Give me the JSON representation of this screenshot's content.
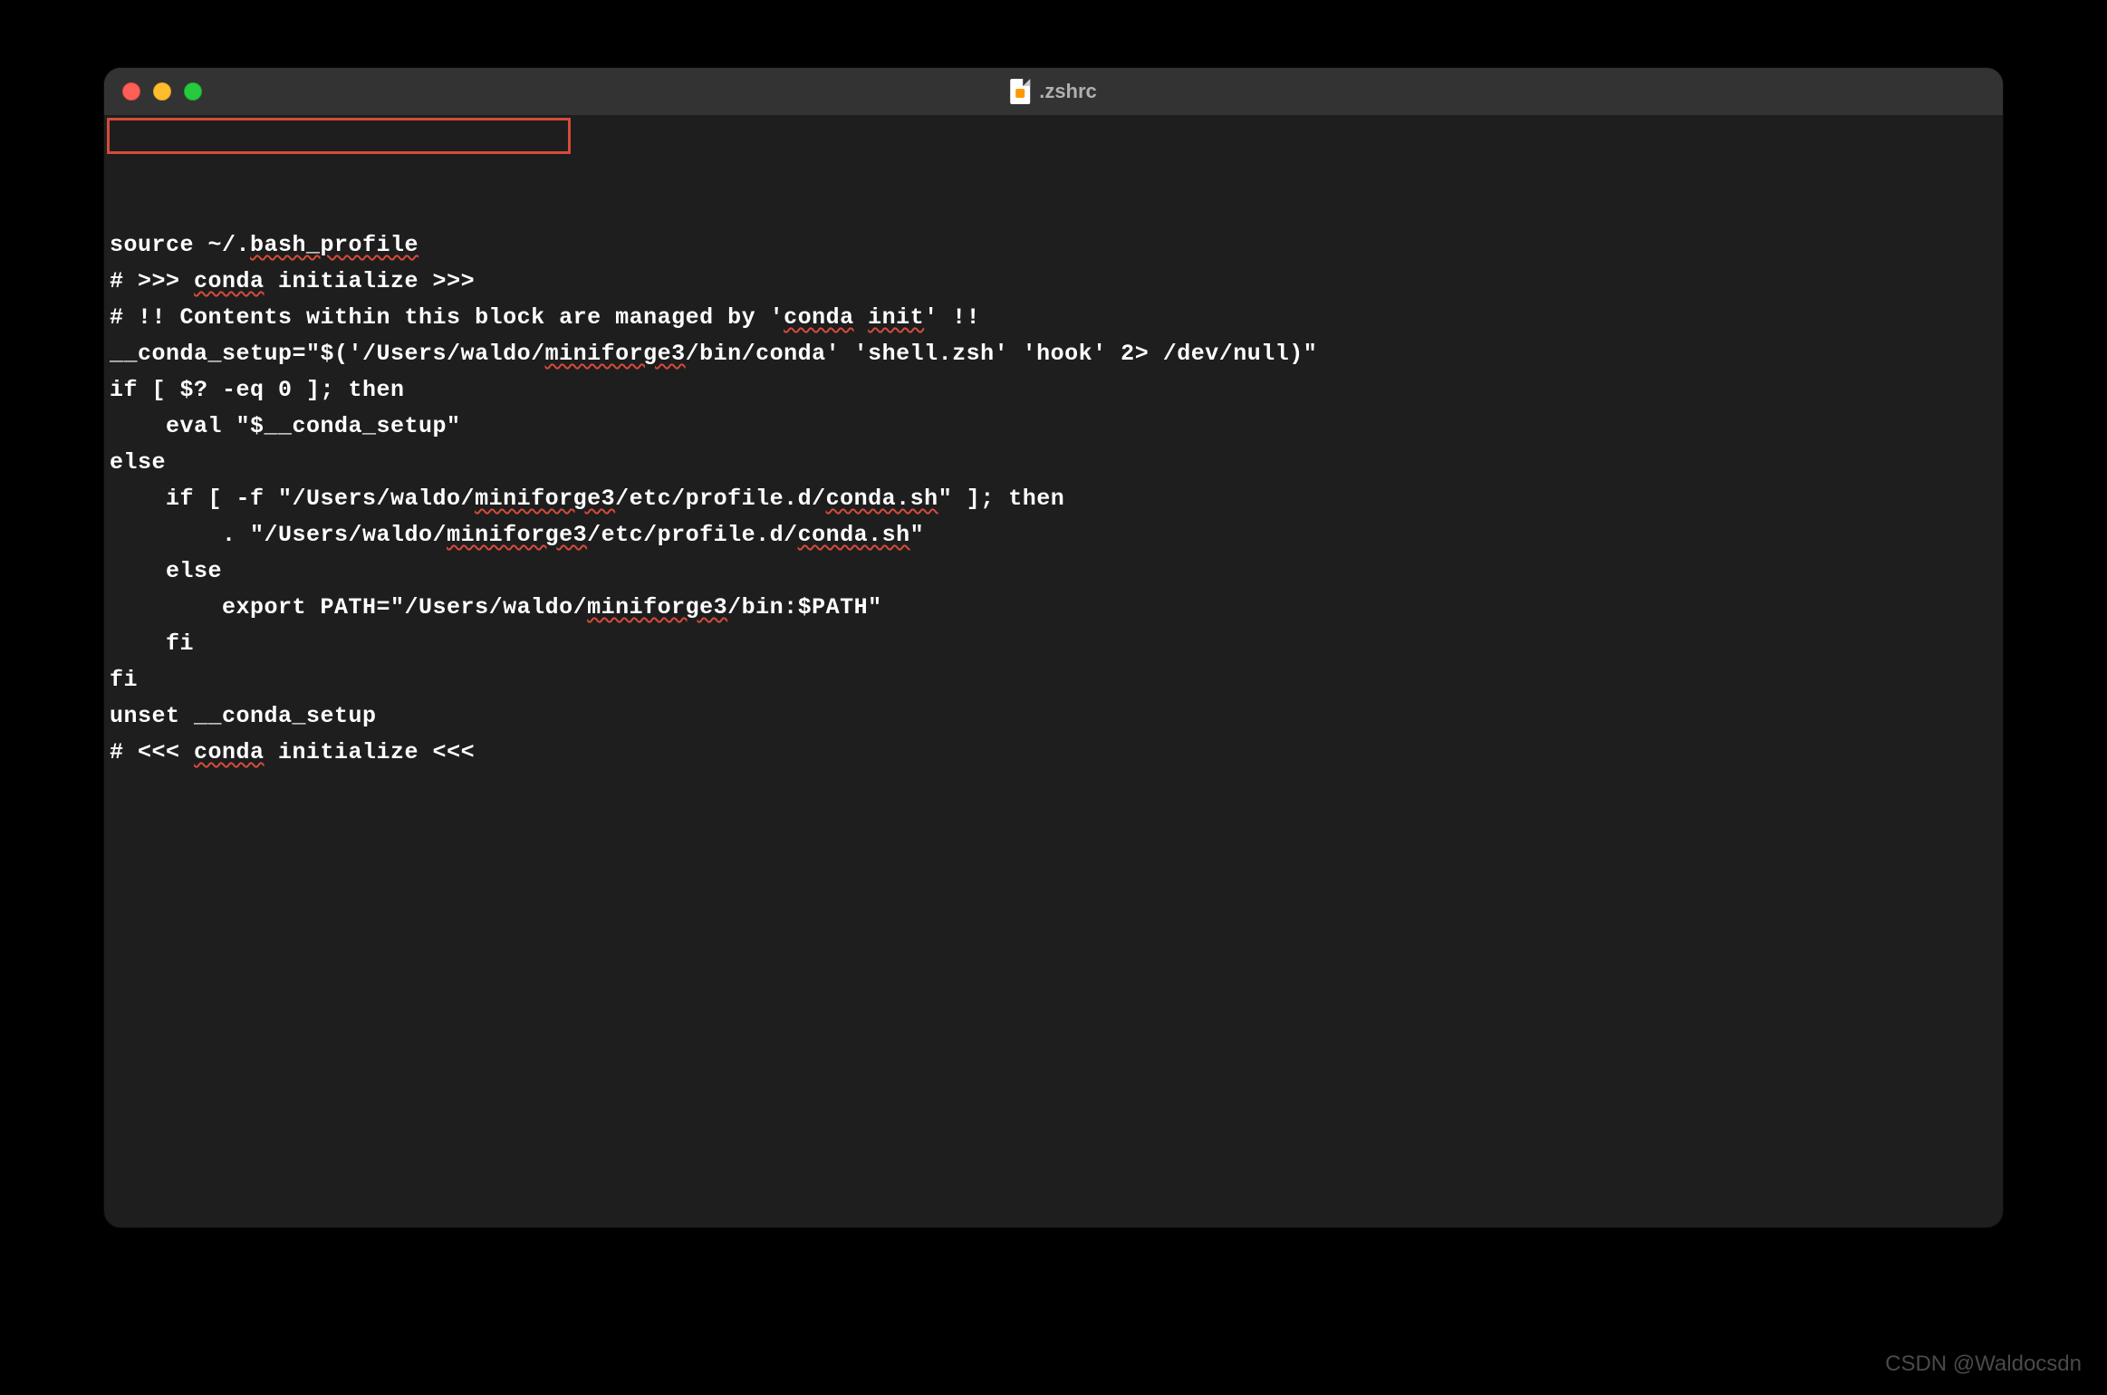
{
  "window": {
    "title": ".zshrc"
  },
  "editor": {
    "lines": [
      [
        {
          "t": "source ~/."
        },
        {
          "t": "bash_profile",
          "w": true
        }
      ],
      [
        {
          "t": "# >>> "
        },
        {
          "t": "conda",
          "w": true
        },
        {
          "t": " initialize >>>"
        }
      ],
      [
        {
          "t": "# !! Contents within this block are managed by '"
        },
        {
          "t": "conda",
          "w": true
        },
        {
          "t": " "
        },
        {
          "t": "init",
          "w": true
        },
        {
          "t": "' !!"
        }
      ],
      [
        {
          "t": "__conda_setup=\"$('/Users/waldo/"
        },
        {
          "t": "miniforge3",
          "w": true
        },
        {
          "t": "/bin/conda' 'shell.zsh' 'hook' 2> /dev/null)\""
        }
      ],
      [
        {
          "t": "if [ $? -eq 0 ]; then"
        }
      ],
      [
        {
          "t": "    eval \"$__conda_setup\""
        }
      ],
      [
        {
          "t": "else"
        }
      ],
      [
        {
          "t": "    if [ -f \"/Users/waldo/"
        },
        {
          "t": "miniforge3",
          "w": true
        },
        {
          "t": "/etc/profile.d/"
        },
        {
          "t": "conda.sh",
          "w": true
        },
        {
          "t": "\" ]; then"
        }
      ],
      [
        {
          "t": "        . \"/Users/waldo/"
        },
        {
          "t": "miniforge3",
          "w": true
        },
        {
          "t": "/etc/profile.d/"
        },
        {
          "t": "conda.sh",
          "w": true
        },
        {
          "t": "\""
        }
      ],
      [
        {
          "t": "    else"
        }
      ],
      [
        {
          "t": "        export PATH=\"/Users/waldo/"
        },
        {
          "t": "miniforge3",
          "w": true
        },
        {
          "t": "/bin:$PATH\""
        }
      ],
      [
        {
          "t": "    fi"
        }
      ],
      [
        {
          "t": "fi"
        }
      ],
      [
        {
          "t": "unset __conda_setup"
        }
      ],
      [
        {
          "t": "# <<< "
        },
        {
          "t": "conda",
          "w": true
        },
        {
          "t": " initialize <<<"
        }
      ]
    ]
  },
  "watermark": "CSDN @Waldocsdn"
}
